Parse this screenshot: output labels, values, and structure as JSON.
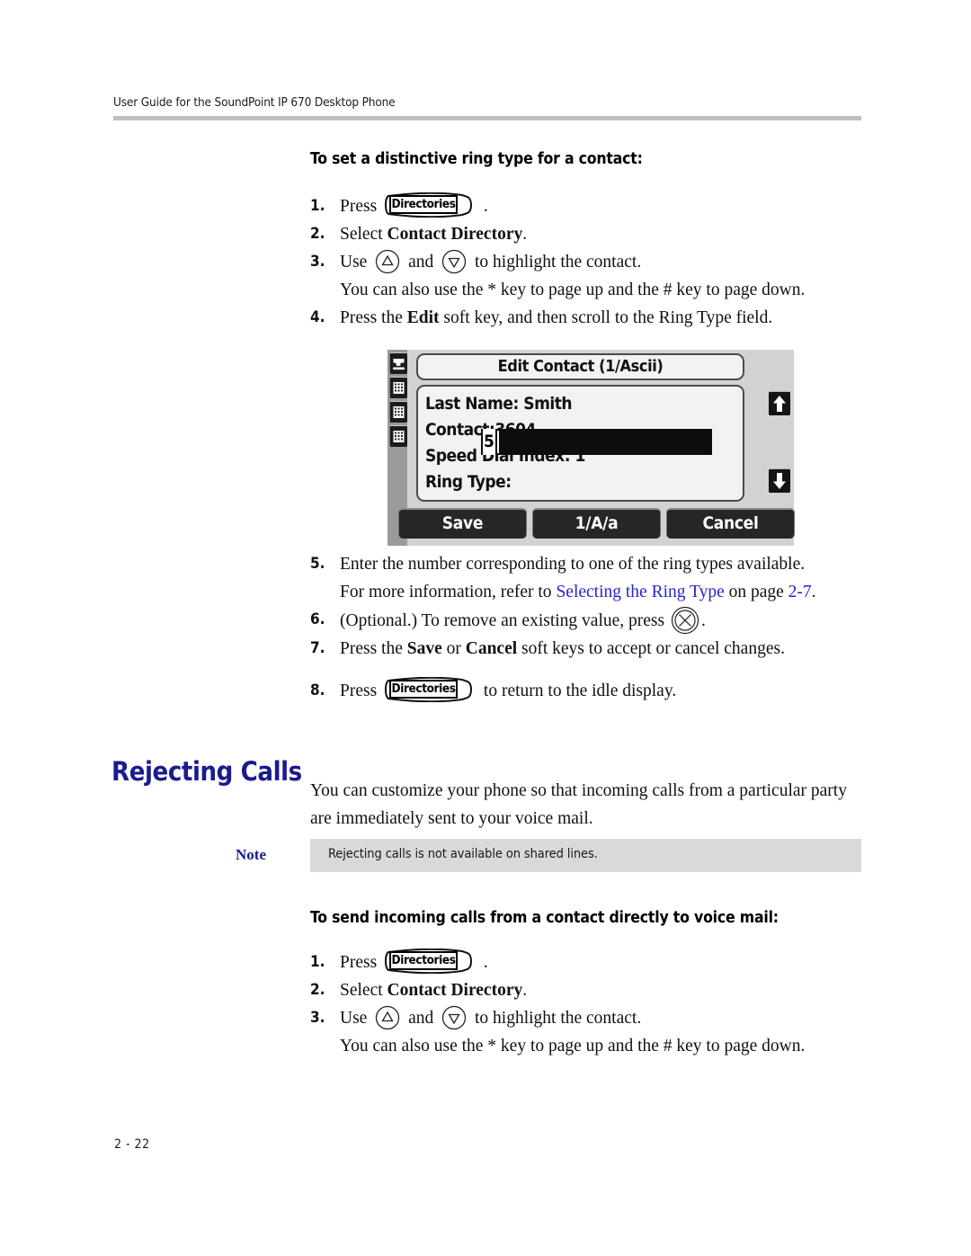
{
  "header": {
    "running_title": "User Guide for the SoundPoint IP 670 Desktop Phone"
  },
  "footer": {
    "page_number": "2 - 22"
  },
  "colors": {
    "heading_blue": "#1b1b8f",
    "link_blue": "#2626cc",
    "rule_gray": "#bfbfbf",
    "note_bg": "#d9d9d9"
  },
  "procedure_one": {
    "title": "To set a distinctive ring type for a contact:",
    "steps": [
      {
        "num": "1.",
        "pre": "Press",
        "key": "Directories",
        "post": "."
      },
      {
        "num": "2.",
        "pre": "Select ",
        "strong": "Contact Directory",
        "post": "."
      },
      {
        "num": "3.",
        "pre": "Use",
        "mid": "and",
        "post": "to highlight the contact.",
        "note": "You can also use the * key to page up and the # key to page down."
      },
      {
        "num": "4.",
        "pre": "Press the ",
        "strong": "Edit",
        "post": " soft key, and then scroll to the Ring Type field."
      },
      {
        "num": "5.",
        "text": "Enter the number corresponding to one of the ring types available.",
        "note_pre": "For more information, refer to ",
        "note_link": "Selecting the Ring Type",
        "note_mid": " on page ",
        "note_link2": "2-7",
        "note_post": "."
      },
      {
        "num": "6.",
        "pre": "(Optional.) To remove an existing value, press",
        "post": "."
      },
      {
        "num": "7.",
        "pre": "Press the ",
        "strong": "Save",
        "mid": " or ",
        "strong2": "Cancel",
        "post": " soft keys to accept or cancel changes."
      },
      {
        "num": "8.",
        "pre": "Press",
        "key": "Directories",
        "post": "to return to the idle display."
      }
    ]
  },
  "lcd": {
    "title": "Edit Contact (1/Ascii)",
    "fields": [
      {
        "label": "Last Name:",
        "value": " Smith"
      },
      {
        "label": "Contact:",
        "value": "3604"
      },
      {
        "label": "Speed Dial Index:",
        "value": " 1"
      }
    ],
    "selected_field": {
      "label": "Ring Type:",
      "value": "5"
    },
    "side_keys": [
      "handset-icon",
      "keypad-icon",
      "keypad-icon",
      "keypad-icon"
    ],
    "scroll_keys": [
      "scroll-up-icon",
      "scroll-down-icon"
    ],
    "soft_keys": [
      "Save",
      "1/A/a",
      "Cancel"
    ]
  },
  "chapter": {
    "heading": "Rejecting Calls",
    "intro_line1": "You can customize your phone so that incoming calls from a particular party",
    "intro_line2": "are immediately sent to your voice mail."
  },
  "note": {
    "label": "Note",
    "text": "Rejecting calls is not available on shared lines."
  },
  "procedure_two": {
    "title": "To send incoming calls from a contact directly to voice mail:",
    "steps": [
      {
        "num": "1.",
        "pre": "Press",
        "key": "Directories",
        "post": "."
      },
      {
        "num": "2.",
        "pre": "Select ",
        "strong": "Contact Directory",
        "post": "."
      },
      {
        "num": "3.",
        "pre": "Use",
        "mid": "and",
        "post": "to highlight the contact.",
        "note": "You can also use the * key to page up and the # key to page down."
      }
    ]
  }
}
